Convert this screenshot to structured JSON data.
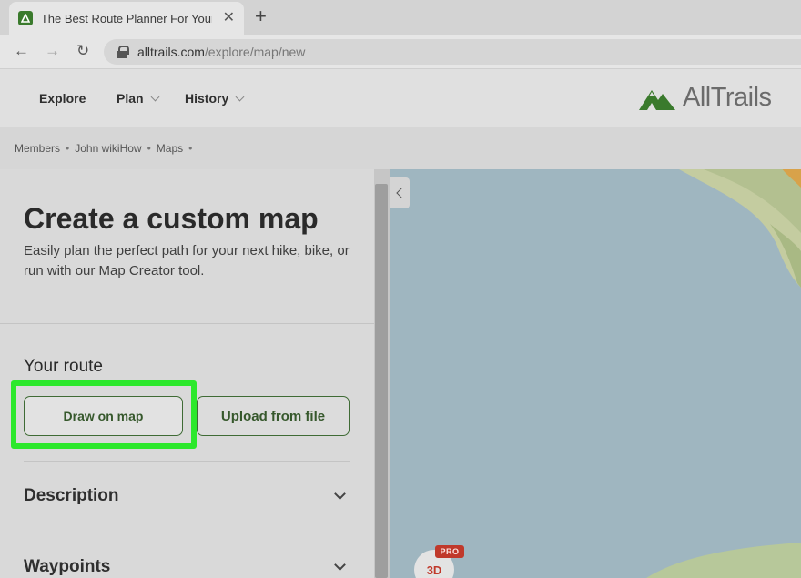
{
  "browser": {
    "tab_title": "The Best Route Planner For Your",
    "tab_close": "✕",
    "new_tab": "+",
    "url_host": "alltrails.com",
    "url_path": "/explore/map/new",
    "back_icon": "←",
    "forward_icon": "→",
    "reload_icon": "↻"
  },
  "site_nav": {
    "explore": "Explore",
    "plan": "Plan",
    "history": "History",
    "logo_text": "AllTrails"
  },
  "breadcrumb": [
    "Members",
    "John wikiHow",
    "Maps"
  ],
  "panel": {
    "title": "Create a custom map",
    "description": "Easily plan the perfect path for your next hike, bike, or run with our Map Creator tool.",
    "route_heading": "Your route",
    "draw_button": "Draw on map",
    "upload_button": "Upload from file",
    "sections": [
      "Description",
      "Waypoints"
    ]
  },
  "map": {
    "btn_3d": "3D",
    "pro_badge": "PRO"
  },
  "colors": {
    "brand_green": "#3a7a2c",
    "highlight": "#2ce82c",
    "pro_red": "#c0392b",
    "water": "#9fb6c0",
    "land": "#c4cca0"
  }
}
